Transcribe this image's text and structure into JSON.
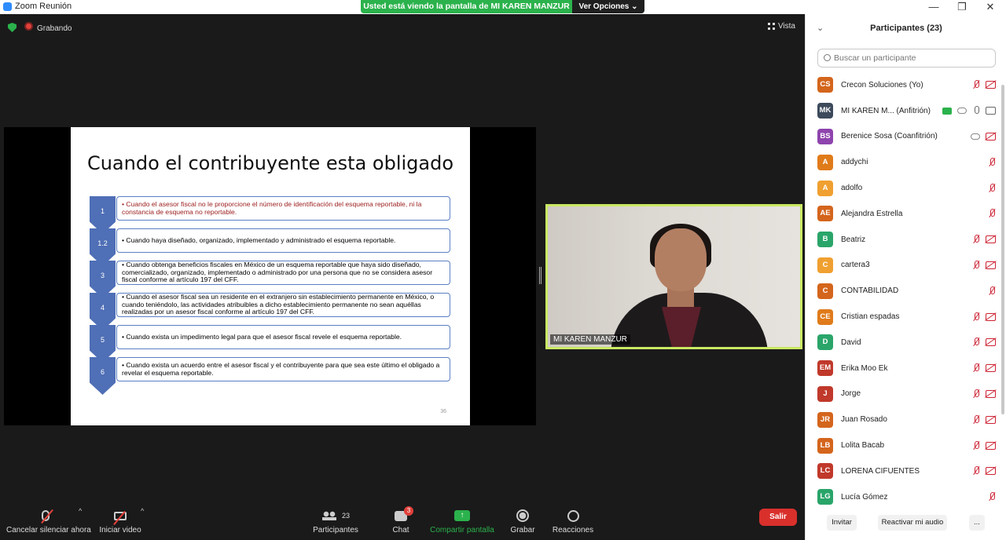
{
  "window": {
    "title": "Zoom Reunión",
    "minimize": "—",
    "maximize": "❐",
    "close": "✕"
  },
  "banner": {
    "message": "Usted está viendo la pantalla de MI KAREN MANZUR",
    "options": "Ver Opciones ⌄"
  },
  "status": {
    "recording": "Grabando",
    "view": "Vista"
  },
  "slide": {
    "title": "Cuando el contribuyente esta obligado",
    "items": [
      {
        "num": "1",
        "text": "• Cuando el asesor fiscal no le proporcione el número de identificación del esquema reportable, ni la constancia de esquema no reportable."
      },
      {
        "num": "1.2",
        "text": "• Cuando haya diseñado, organizado, implementado y administrado el esquema reportable."
      },
      {
        "num": "3",
        "text": "• Cuando obtenga beneficios fiscales en México de un esquema reportable que haya sido diseñado, comercializado, organizado, implementado o administrado por una persona que no se considera asesor fiscal conforme al artículo 197 del CFF."
      },
      {
        "num": "4",
        "text": "• Cuando el asesor fiscal sea un residente en el extranjero sin establecimiento permanente en México, o cuando teniéndolo, las actividades atribuibles a dicho establecimiento permanente no sean aquéllas realizadas por un asesor fiscal conforme al artículo 197 del CFF."
      },
      {
        "num": "5",
        "text": "• Cuando exista un impedimento legal para que el asesor fiscal revele el esquema reportable."
      },
      {
        "num": "6",
        "text": "• Cuando exista un acuerdo entre el asesor fiscal y el contribuyente para que sea este último el obligado a revelar el esquema reportable."
      }
    ],
    "page": "36"
  },
  "video": {
    "name": "MI KAREN MANZUR"
  },
  "toolbar": {
    "mute": "Cancelar silenciar ahora",
    "video": "Iniciar video",
    "participants": "Participantes",
    "participants_count": "23",
    "chat": "Chat",
    "chat_badge": "3",
    "share": "Compartir pantalla",
    "record": "Grabar",
    "reactions": "Reacciones",
    "leave": "Salir",
    "caret": "^"
  },
  "panel": {
    "title": "Participantes (23)",
    "search_placeholder": "Buscar un participante",
    "participants": [
      {
        "initials": "CS",
        "name": "Crecon Soluciones (Yo)",
        "color": "#d4651c",
        "icons": [
          "mic-off",
          "cam-off"
        ]
      },
      {
        "initials": "MK",
        "name": "MI KAREN M... (Anfitrión)",
        "color": "#3d4a5c",
        "icons": [
          "share",
          "cloud",
          "mic-on",
          "cam-on"
        ]
      },
      {
        "initials": "BS",
        "name": "Berenice Sosa  (Coanfitrión)",
        "color": "#8e44ad",
        "icons": [
          "cloud",
          "cam-off"
        ]
      },
      {
        "initials": "A",
        "name": "addychi",
        "color": "#e07b1a",
        "icons": [
          "mic-off"
        ]
      },
      {
        "initials": "A",
        "name": "adolfo",
        "color": "#f0a030",
        "icons": [
          "mic-off"
        ]
      },
      {
        "initials": "AE",
        "name": "Alejandra Estrella",
        "color": "#d4651c",
        "icons": [
          "mic-off"
        ]
      },
      {
        "initials": "B",
        "name": "Beatriz",
        "color": "#2aa56a",
        "icons": [
          "mic-off",
          "cam-off"
        ]
      },
      {
        "initials": "C",
        "name": "cartera3",
        "color": "#f0a030",
        "icons": [
          "mic-off",
          "cam-off"
        ]
      },
      {
        "initials": "C",
        "name": "CONTABILIDAD",
        "color": "#d4651c",
        "icons": [
          "mic-off"
        ]
      },
      {
        "initials": "CE",
        "name": "Cristian espadas",
        "color": "#e07b1a",
        "icons": [
          "mic-off",
          "cam-off"
        ]
      },
      {
        "initials": "D",
        "name": "David",
        "color": "#2aa56a",
        "icons": [
          "mic-off",
          "cam-off"
        ]
      },
      {
        "initials": "EM",
        "name": "Erika Moo Ek",
        "color": "#c0392b",
        "icons": [
          "mic-off",
          "cam-off"
        ]
      },
      {
        "initials": "J",
        "name": "Jorge",
        "color": "#c0392b",
        "icons": [
          "mic-off",
          "cam-off"
        ]
      },
      {
        "initials": "JR",
        "name": "Juan Rosado",
        "color": "#d4651c",
        "icons": [
          "mic-off",
          "cam-off"
        ]
      },
      {
        "initials": "LB",
        "name": "Lolita Bacab",
        "color": "#d4651c",
        "icons": [
          "mic-off",
          "cam-off"
        ]
      },
      {
        "initials": "LC",
        "name": "LORENA CIFUENTES",
        "color": "#c0392b",
        "icons": [
          "mic-off",
          "cam-off"
        ]
      },
      {
        "initials": "LG",
        "name": "Lucía Gómez",
        "color": "#2aa56a",
        "icons": [
          "mic-off"
        ]
      }
    ],
    "invite": "Invitar",
    "unmute": "Reactivar mi audio",
    "more": "..."
  }
}
